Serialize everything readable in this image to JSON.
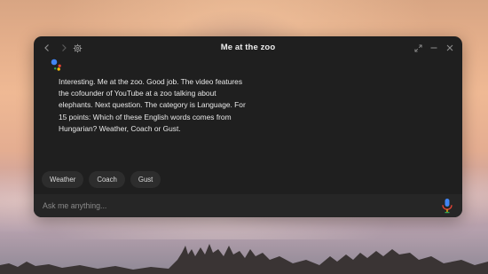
{
  "window": {
    "title": "Me at the zoo"
  },
  "titlebar": {
    "back_icon": "chevron-left-icon",
    "forward_icon": "chevron-right-icon",
    "settings_icon": "gear-icon",
    "expand_icon": "expand-icon",
    "minimize_icon": "minimize-icon",
    "close_icon": "close-icon"
  },
  "assistant": {
    "logo_icon": "assistant-dots-icon",
    "response_text": "Interesting.  Me at the zoo. Good job.  The video features\nthe cofounder of YouTube at a zoo talking about\nelephants.  Next question. The category is Language.  For\n15 points:  Which of these English words comes from\nHungarian? Weather,  Coach  or Gust."
  },
  "suggestions": [
    {
      "label": "Weather"
    },
    {
      "label": "Coach"
    },
    {
      "label": "Gust"
    }
  ],
  "input": {
    "placeholder": "Ask me anything...",
    "value": "",
    "mic_icon": "microphone-icon"
  },
  "colors": {
    "window_bg": "#1f1f1f",
    "chip_bg": "#2d2d2d",
    "input_bg": "#262626",
    "google_blue": "#4285f4",
    "google_red": "#ea4335",
    "google_yellow": "#fbbc05",
    "google_green": "#34a853"
  }
}
